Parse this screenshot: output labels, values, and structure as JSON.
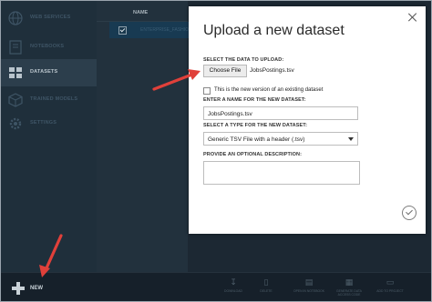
{
  "sidebar": {
    "items": [
      {
        "label": "WEB SERVICES",
        "icon": "globe-icon",
        "active": false
      },
      {
        "label": "NOTEBOOKS",
        "icon": "notebook-icon",
        "active": false
      },
      {
        "label": "DATASETS",
        "icon": "datasets-icon",
        "active": true
      },
      {
        "label": "TRAINED MODELS",
        "icon": "cube-icon",
        "active": false
      },
      {
        "label": "SETTINGS",
        "icon": "gear-icon",
        "active": false
      }
    ]
  },
  "list": {
    "column_header": "NAME",
    "row_text": "ENTERPRISE_FASHION..."
  },
  "dialog": {
    "title": "Upload a new dataset",
    "select_data_label": "SELECT THE DATA TO UPLOAD:",
    "choose_file_label": "Choose File",
    "chosen_file_name": "JobsPostings.tsv",
    "existing_version_label": "This is the new version of an existing dataset",
    "existing_version_checked": false,
    "name_label": "ENTER A NAME FOR THE NEW DATASET:",
    "name_value": "JobsPostings.tsv",
    "type_label": "SELECT A TYPE FOR THE NEW DATASET:",
    "type_value": "Generic TSV File with a header (.tsv)",
    "description_label": "PROVIDE AN OPTIONAL DESCRIPTION:",
    "description_value": ""
  },
  "bottom_bar": {
    "new_label": "NEW",
    "commands": [
      {
        "label": "DOWNLOAD",
        "icon": "download-icon"
      },
      {
        "label": "DELETE",
        "icon": "trash-icon"
      },
      {
        "label": "OPEN IN NOTEBOOK",
        "icon": "notebook-icon"
      },
      {
        "label": "GENERATE DATA ACCESS CODE",
        "icon": "code-icon"
      },
      {
        "label": "ADD TO PROJECT",
        "icon": "folder-icon"
      }
    ]
  },
  "colors": {
    "annotation_arrow": "#e0403a",
    "background": "#1c2833"
  }
}
